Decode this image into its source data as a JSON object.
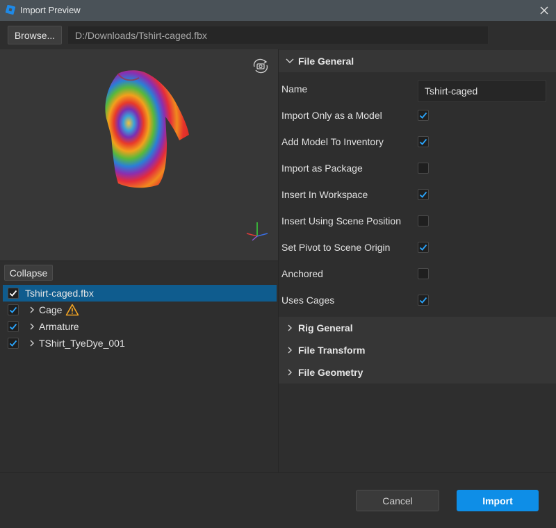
{
  "window": {
    "title": "Import Preview"
  },
  "toolbar": {
    "browse_label": "Browse...",
    "file_path": "D:/Downloads/Tshirt-caged.fbx"
  },
  "tree": {
    "collapse_label": "Collapse",
    "items": [
      {
        "label": "Tshirt-caged.fbx",
        "checked": true,
        "selected": true,
        "expandable": false,
        "warning": false
      },
      {
        "label": "Cage",
        "checked": true,
        "selected": false,
        "expandable": true,
        "warning": true
      },
      {
        "label": "Armature",
        "checked": true,
        "selected": false,
        "expandable": true,
        "warning": false
      },
      {
        "label": "TShirt_TyeDye_001",
        "checked": true,
        "selected": false,
        "expandable": true,
        "warning": false
      }
    ]
  },
  "file_general": {
    "title": "File General",
    "expanded": true,
    "name_label": "Name",
    "name_value": "Tshirt-caged",
    "properties": [
      {
        "label": "Import Only as a Model",
        "checked": true
      },
      {
        "label": "Add Model To Inventory",
        "checked": true
      },
      {
        "label": "Import as Package",
        "checked": false
      },
      {
        "label": "Insert In Workspace",
        "checked": true
      },
      {
        "label": "Insert Using Scene Position",
        "checked": false
      },
      {
        "label": "Set Pivot to Scene Origin",
        "checked": true
      },
      {
        "label": "Anchored",
        "checked": false
      },
      {
        "label": "Uses Cages",
        "checked": true
      }
    ]
  },
  "collapsed_sections": [
    {
      "title": "Rig General"
    },
    {
      "title": "File Transform"
    },
    {
      "title": "File Geometry"
    }
  ],
  "footer": {
    "cancel_label": "Cancel",
    "import_label": "Import"
  },
  "colors": {
    "accent": "#0e8ee7",
    "selection": "#0f5c8e",
    "check": "#2aa6ff",
    "warning": "#f5a623"
  }
}
